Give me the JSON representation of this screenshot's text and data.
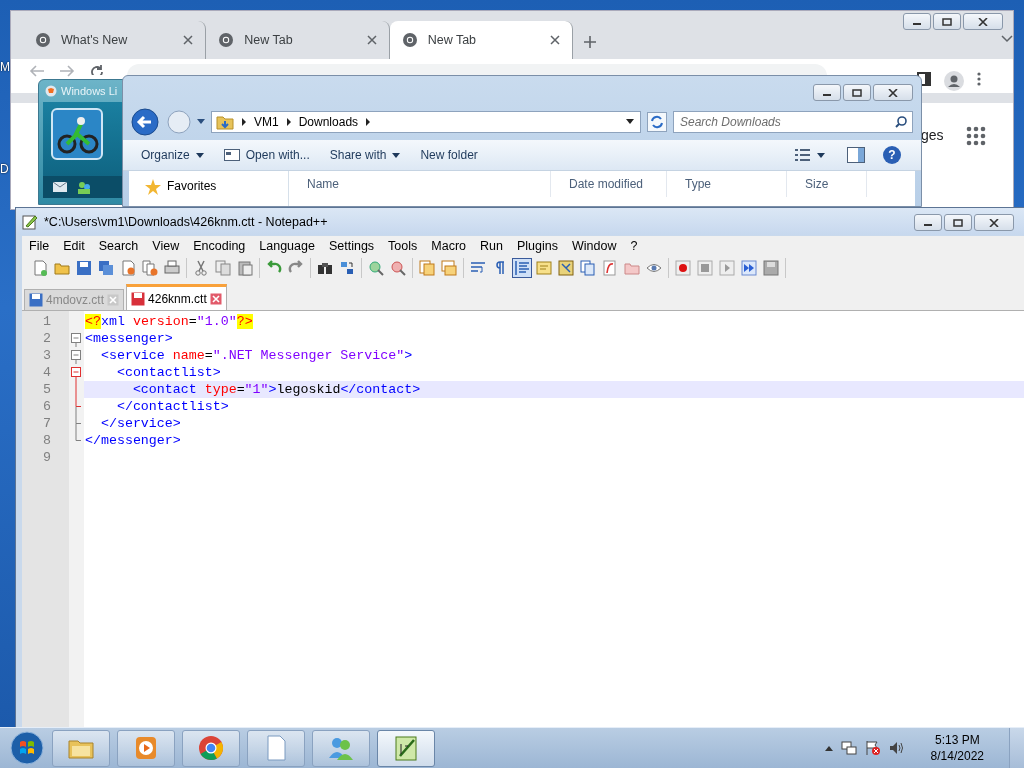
{
  "desktop": {
    "icon_labels": [
      "M",
      "D"
    ]
  },
  "chrome": {
    "tabs": [
      {
        "title": "What's New",
        "selected": false
      },
      {
        "title": "New Tab",
        "selected": false
      },
      {
        "title": "New Tab",
        "selected": true
      }
    ],
    "page_fragment": "ges"
  },
  "messenger_window": {
    "title": "Windows Li"
  },
  "explorer": {
    "breadcrumb": [
      "VM1",
      "Downloads"
    ],
    "search": {
      "placeholder": "Search Downloads"
    },
    "commands": [
      {
        "label": "Organize",
        "kind": "menu"
      },
      {
        "label": "Open with...",
        "kind": "icon"
      },
      {
        "label": "Share with",
        "kind": "menu"
      },
      {
        "label": "New folder",
        "kind": "plain"
      }
    ],
    "help_button": "?",
    "nav": [
      "Favorites"
    ],
    "columns": [
      "Name",
      "Date modified",
      "Type",
      "Size"
    ]
  },
  "notepad": {
    "title": "*C:\\Users\\vm1\\Downloads\\426knm.ctt - Notepad++",
    "menu": [
      "File",
      "Edit",
      "Search",
      "View",
      "Encoding",
      "Language",
      "Settings",
      "Tools",
      "Macro",
      "Run",
      "Plugins",
      "Window",
      "?"
    ],
    "toolbar": [
      [
        {
          "selected": false
        },
        {
          "selected": false
        },
        {
          "selected": false
        },
        {
          "selected": false
        },
        {
          "selected": false
        },
        {
          "selected": false
        },
        {
          "selected": false
        }
      ],
      [
        {
          "selected": false
        },
        {
          "selected": false
        },
        {
          "selected": false
        }
      ],
      [
        {
          "selected": false
        },
        {
          "selected": false
        }
      ],
      [
        {
          "selected": false
        },
        {
          "selected": false
        }
      ],
      [
        {
          "selected": false
        },
        {
          "selected": false
        }
      ],
      [
        {
          "selected": false
        },
        {
          "selected": false
        }
      ],
      [
        {
          "selected": false
        },
        {
          "selected": false
        },
        {
          "selected": true
        },
        {
          "selected": false
        },
        {
          "selected": false
        },
        {
          "selected": false
        },
        {
          "selected": false
        },
        {
          "selected": false
        },
        {
          "selected": false
        }
      ],
      [
        {
          "selected": false
        },
        {
          "selected": false
        },
        {
          "selected": false
        },
        {
          "selected": false
        },
        {
          "selected": false
        }
      ]
    ],
    "tabs": [
      {
        "label": "4mdovz.ctt",
        "selected": false,
        "modified": false
      },
      {
        "label": "426knm.ctt",
        "selected": true,
        "modified": true
      }
    ],
    "lines": [
      {
        "number": "1",
        "current": false,
        "tokens": [
          {
            "kind": "pi",
            "text": "<?"
          },
          {
            "kind": "tag",
            "text": "xml"
          },
          {
            "kind": "attr",
            "text": " version"
          },
          {
            "kind": "text",
            "text": "="
          },
          {
            "kind": "value",
            "text": "\"1.0\""
          },
          {
            "kind": "pi",
            "text": "?>"
          }
        ]
      },
      {
        "number": "2",
        "current": false,
        "fold": {
          "kind": "open",
          "active": false
        },
        "tokens": [
          {
            "kind": "tag",
            "text": "<messenger>"
          }
        ]
      },
      {
        "number": "3",
        "current": false,
        "fold": {
          "kind": "open",
          "active": false
        },
        "tokens": [
          {
            "kind": "tag",
            "text": "  <service"
          },
          {
            "kind": "attr",
            "text": " name"
          },
          {
            "kind": "text",
            "text": "="
          },
          {
            "kind": "value",
            "text": "\".NET Messenger Service\""
          },
          {
            "kind": "tag",
            "text": ">"
          }
        ]
      },
      {
        "number": "4",
        "current": false,
        "fold": {
          "kind": "open",
          "active": true
        },
        "tokens": [
          {
            "kind": "tag",
            "text": "    <contactlist>"
          }
        ]
      },
      {
        "number": "5",
        "current": true,
        "fold": {
          "kind": "line",
          "active": true
        },
        "tokens": [
          {
            "kind": "tag",
            "text": "      <contact"
          },
          {
            "kind": "attr",
            "text": " type"
          },
          {
            "kind": "text",
            "text": "="
          },
          {
            "kind": "value",
            "text": "\"1\""
          },
          {
            "kind": "tag",
            "text": ">"
          },
          {
            "kind": "text",
            "text": "legoskid"
          },
          {
            "kind": "tag",
            "text": "</contact>"
          }
        ]
      },
      {
        "number": "6",
        "current": false,
        "fold": {
          "kind": "end",
          "active": true
        },
        "tokens": [
          {
            "kind": "tag",
            "text": "    </contactlist>"
          }
        ]
      },
      {
        "number": "7",
        "current": false,
        "fold": {
          "kind": "end",
          "active": false
        },
        "tokens": [
          {
            "kind": "tag",
            "text": "  </service>"
          }
        ]
      },
      {
        "number": "8",
        "current": false,
        "fold": {
          "kind": "last",
          "active": false
        },
        "tokens": [
          {
            "kind": "tag",
            "text": "</messenger>"
          }
        ]
      },
      {
        "number": "9",
        "current": false
      }
    ]
  },
  "taskbar": {
    "buttons": [
      {
        "selected": false
      },
      {
        "selected": false
      },
      {
        "selected": false
      },
      {
        "selected": false
      },
      {
        "selected": false
      },
      {
        "selected": true
      }
    ],
    "time": "5:13 PM",
    "date": "8/14/2022"
  }
}
